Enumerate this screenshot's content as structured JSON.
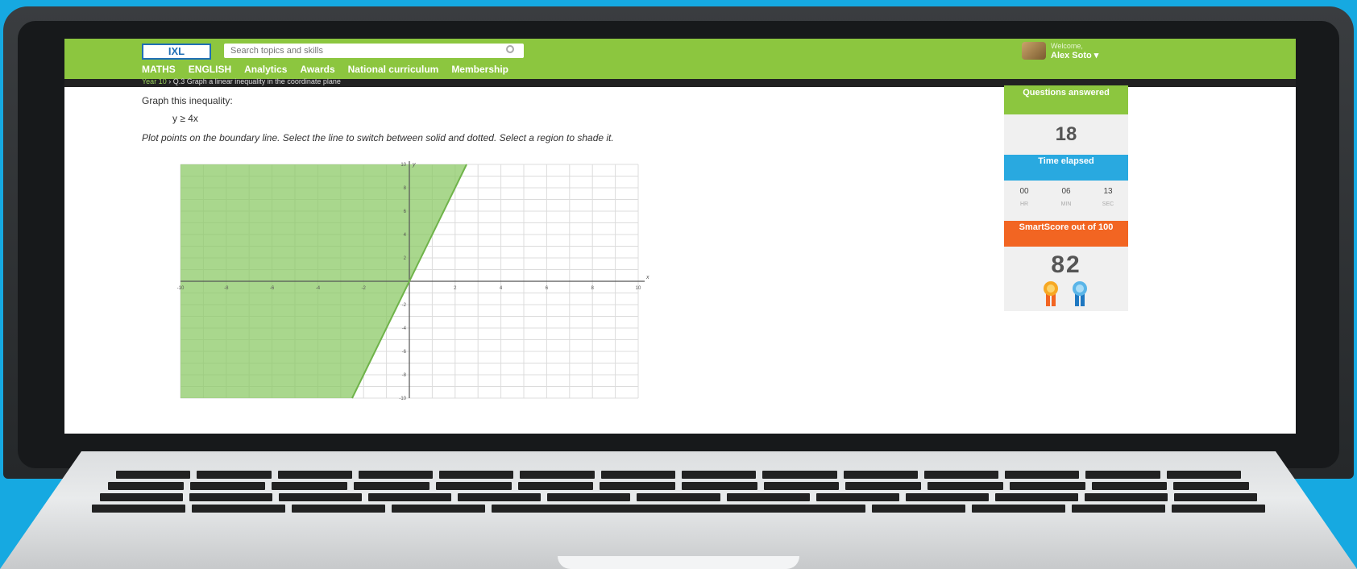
{
  "header": {
    "logo": "IXL",
    "search_placeholder": "Search topics and skills",
    "nav": [
      "MATHS",
      "ENGLISH",
      "Analytics",
      "Awards",
      "National curriculum",
      "Membership"
    ],
    "welcome": "Welcome,",
    "username": "Alex Soto ▾"
  },
  "breadcrumb": {
    "level": "Year 10",
    "separator": "›",
    "skill": "Q.3 Graph a linear inequality in the coordinate plane"
  },
  "question": {
    "instruction": "Graph this inequality:",
    "expression": "y ≥ 4x",
    "directions": "Plot points on the boundary line. Select the line to switch between solid and dotted. Select a region to shade it."
  },
  "sidebar": {
    "questions_answered_label": "Questions answered",
    "questions_answered": "18",
    "time_elapsed_label": "Time elapsed",
    "time": [
      {
        "value": "00",
        "unit": "HR"
      },
      {
        "value": "06",
        "unit": "MIN"
      },
      {
        "value": "13",
        "unit": "SEC"
      }
    ],
    "smartscore_label": "SmartScore out of 100",
    "smartscore": "82"
  },
  "chart_data": {
    "type": "line",
    "title": "",
    "xlabel": "x",
    "ylabel": "y",
    "xlim": [
      -10,
      10
    ],
    "ylim": [
      -10,
      10
    ],
    "x_ticks": [
      -10,
      -8,
      -6,
      -4,
      -2,
      2,
      4,
      6,
      8,
      10
    ],
    "y_ticks": [
      10,
      8,
      6,
      4,
      2,
      -2,
      -4,
      -6,
      -8,
      -10
    ],
    "grid": true,
    "series": [
      {
        "x": [
          -2.5,
          2.5
        ],
        "y": [
          -10,
          10
        ]
      }
    ],
    "shaded_region": "left of boundary line (y ≥ 4x)",
    "shade_color": "#8cc967",
    "line_color": "#6fb34a"
  }
}
